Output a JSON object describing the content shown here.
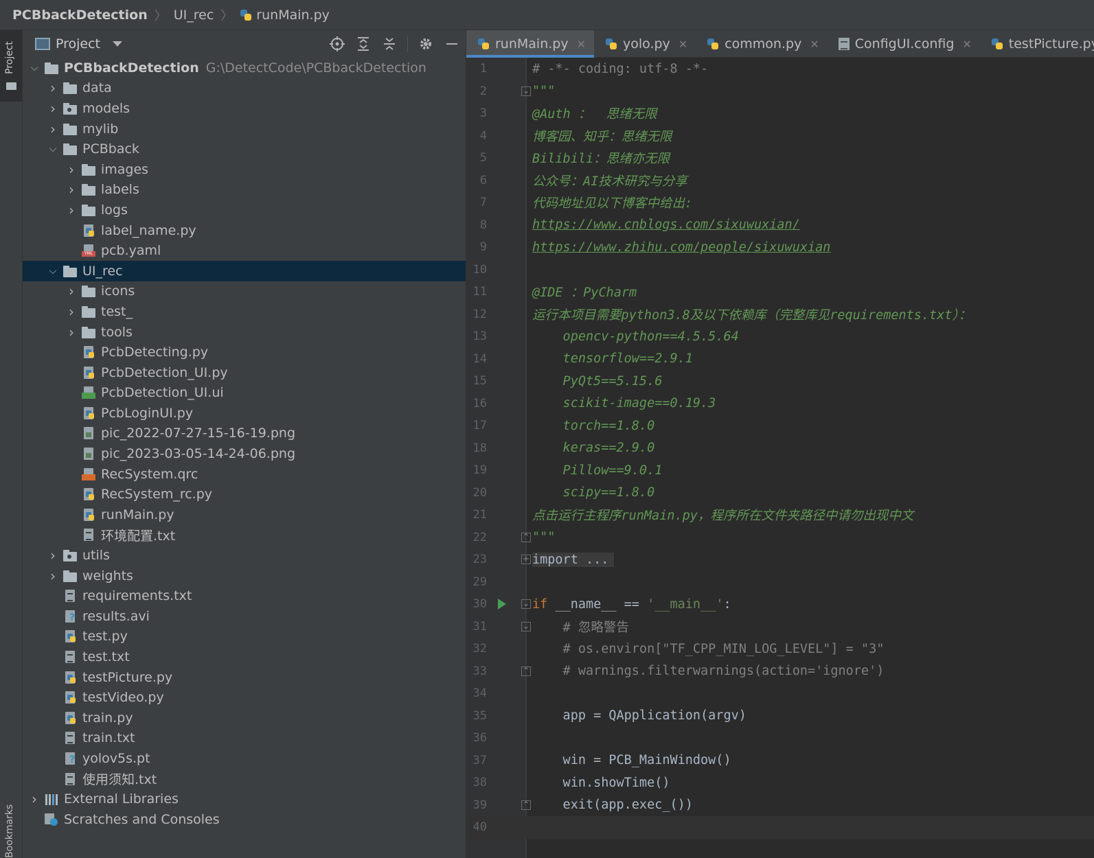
{
  "breadcrumb": {
    "root": "PCBbackDetection",
    "folder": "UI_rec",
    "file": "runMain.py"
  },
  "left_strip": {
    "project_label": "Project",
    "bookmarks_label": "Bookmarks"
  },
  "project_panel": {
    "title": "Project",
    "tool_icons": [
      "locate-icon",
      "expand-all-icon",
      "collapse-all-icon",
      "settings-icon",
      "hide-icon"
    ],
    "tree": [
      {
        "depth": 0,
        "expanded": true,
        "icon": "folder",
        "label": "PCBbackDetection",
        "path": "G:\\DetectCode\\PCBbackDetection",
        "bold": true
      },
      {
        "depth": 1,
        "expanded": false,
        "icon": "folder",
        "label": "data"
      },
      {
        "depth": 1,
        "expanded": false,
        "icon": "folder-pkg",
        "label": "models"
      },
      {
        "depth": 1,
        "expanded": false,
        "icon": "folder",
        "label": "mylib"
      },
      {
        "depth": 1,
        "expanded": true,
        "icon": "folder",
        "label": "PCBback"
      },
      {
        "depth": 2,
        "expanded": false,
        "icon": "folder",
        "label": "images"
      },
      {
        "depth": 2,
        "expanded": false,
        "icon": "folder",
        "label": "labels"
      },
      {
        "depth": 2,
        "expanded": false,
        "icon": "folder",
        "label": "logs"
      },
      {
        "depth": 2,
        "icon": "python",
        "label": "label_name.py"
      },
      {
        "depth": 2,
        "icon": "yaml",
        "label": "pcb.yaml"
      },
      {
        "depth": 1,
        "expanded": true,
        "icon": "folder",
        "label": "UI_rec",
        "selected": true
      },
      {
        "depth": 2,
        "expanded": false,
        "icon": "folder",
        "label": "icons"
      },
      {
        "depth": 2,
        "expanded": false,
        "icon": "folder",
        "label": "test_"
      },
      {
        "depth": 2,
        "expanded": false,
        "icon": "folder",
        "label": "tools"
      },
      {
        "depth": 2,
        "icon": "python",
        "label": "PcbDetecting.py"
      },
      {
        "depth": 2,
        "icon": "python",
        "label": "PcbDetection_UI.py"
      },
      {
        "depth": 2,
        "icon": "qt",
        "label": "PcbDetection_UI.ui"
      },
      {
        "depth": 2,
        "icon": "python",
        "label": "PcbLoginUI.py"
      },
      {
        "depth": 2,
        "icon": "image",
        "label": "pic_2022-07-27-15-16-19.png"
      },
      {
        "depth": 2,
        "icon": "image",
        "label": "pic_2023-03-05-14-24-06.png"
      },
      {
        "depth": 2,
        "icon": "qrc",
        "label": "RecSystem.qrc"
      },
      {
        "depth": 2,
        "icon": "python",
        "label": "RecSystem_rc.py"
      },
      {
        "depth": 2,
        "icon": "python",
        "label": "runMain.py"
      },
      {
        "depth": 2,
        "icon": "text",
        "label": "环境配置.txt"
      },
      {
        "depth": 1,
        "expanded": false,
        "icon": "folder-pkg",
        "label": "utils"
      },
      {
        "depth": 1,
        "expanded": false,
        "icon": "folder",
        "label": "weights"
      },
      {
        "depth": 1,
        "icon": "text",
        "label": "requirements.txt"
      },
      {
        "depth": 1,
        "icon": "unknown",
        "label": "results.avi"
      },
      {
        "depth": 1,
        "icon": "python",
        "label": "test.py"
      },
      {
        "depth": 1,
        "icon": "text",
        "label": "test.txt"
      },
      {
        "depth": 1,
        "icon": "python",
        "label": "testPicture.py"
      },
      {
        "depth": 1,
        "icon": "python",
        "label": "testVideo.py"
      },
      {
        "depth": 1,
        "icon": "python",
        "label": "train.py"
      },
      {
        "depth": 1,
        "icon": "text",
        "label": "train.txt"
      },
      {
        "depth": 1,
        "icon": "unknown",
        "label": "yolov5s.pt"
      },
      {
        "depth": 1,
        "icon": "text",
        "label": "使用须知.txt"
      },
      {
        "depth": 0,
        "expanded": false,
        "icon": "libs",
        "label": "External Libraries"
      },
      {
        "depth": 0,
        "icon": "scratch",
        "label": "Scratches and Consoles"
      }
    ]
  },
  "editor": {
    "tabs": [
      {
        "label": "runMain.py",
        "icon": "python",
        "active": true
      },
      {
        "label": "yolo.py",
        "icon": "python"
      },
      {
        "label": "common.py",
        "icon": "python"
      },
      {
        "label": "ConfigUI.config",
        "icon": "config"
      },
      {
        "label": "testPicture.py",
        "icon": "python"
      }
    ],
    "lines": [
      {
        "n": "1",
        "style": "comment",
        "text": "# -*- coding: utf-8 -*-"
      },
      {
        "n": "2",
        "style": "doc",
        "text": "\"\"\"",
        "fold": "open"
      },
      {
        "n": "3",
        "style": "doc",
        "text": "@Auth ：  思绪无限"
      },
      {
        "n": "4",
        "style": "doc",
        "text": "博客园、知乎：思绪无限"
      },
      {
        "n": "5",
        "style": "doc",
        "text": "Bilibili：思绪亦无限"
      },
      {
        "n": "6",
        "style": "doc",
        "text": "公众号：AI技术研究与分享"
      },
      {
        "n": "7",
        "style": "doc",
        "text": "代码地址见以下博客中给出:"
      },
      {
        "n": "8",
        "style": "link",
        "text": "https://www.cnblogs.com/sixuwuxian/"
      },
      {
        "n": "9",
        "style": "link",
        "text": "https://www.zhihu.com/people/sixuwuxian"
      },
      {
        "n": "10",
        "style": "doc",
        "text": ""
      },
      {
        "n": "11",
        "style": "doc",
        "text": "@IDE ：PyCharm"
      },
      {
        "n": "12",
        "style": "doc",
        "text": "运行本项目需要python3.8及以下依赖库（完整库见requirements.txt）："
      },
      {
        "n": "13",
        "style": "doc",
        "text": "    opencv-python==4.5.5.64"
      },
      {
        "n": "14",
        "style": "doc",
        "text": "    tensorflow==2.9.1"
      },
      {
        "n": "15",
        "style": "doc",
        "text": "    PyQt5==5.15.6"
      },
      {
        "n": "16",
        "style": "doc",
        "text": "    scikit-image==0.19.3"
      },
      {
        "n": "17",
        "style": "doc",
        "text": "    torch==1.8.0"
      },
      {
        "n": "18",
        "style": "doc",
        "text": "    keras==2.9.0"
      },
      {
        "n": "19",
        "style": "doc",
        "text": "    Pillow==9.0.1"
      },
      {
        "n": "20",
        "style": "doc",
        "text": "    scipy==1.8.0"
      },
      {
        "n": "21",
        "style": "doc",
        "text": "点击运行主程序runMain.py，程序所在文件夹路径中请勿出现中文"
      },
      {
        "n": "22",
        "style": "doc",
        "text": "\"\"\"",
        "fold": "close"
      },
      {
        "n": "23",
        "style": "fold",
        "text": "import ...",
        "fold": "plus"
      },
      {
        "n": "29",
        "style": "plain",
        "text": ""
      },
      {
        "n": "30",
        "style": "ifmain",
        "text": "",
        "fold": "open",
        "run": true
      },
      {
        "n": "31",
        "style": "comment",
        "text": "    # 忽略警告",
        "fold": "open"
      },
      {
        "n": "32",
        "style": "comment",
        "text": "    # os.environ[\"TF_CPP_MIN_LOG_LEVEL\"] = \"3\""
      },
      {
        "n": "33",
        "style": "comment",
        "text": "    # warnings.filterwarnings(action='ignore')",
        "fold": "close"
      },
      {
        "n": "34",
        "style": "plain",
        "text": ""
      },
      {
        "n": "35",
        "style": "plain",
        "text": "    app = QApplication(argv)"
      },
      {
        "n": "36",
        "style": "plain",
        "text": ""
      },
      {
        "n": "37",
        "style": "plain",
        "text": "    win = PCB_MainWindow()"
      },
      {
        "n": "38",
        "style": "plain",
        "text": "    win.showTime()"
      },
      {
        "n": "39",
        "style": "plain",
        "text": "    exit(app.exec_())",
        "fold": "close"
      },
      {
        "n": "40",
        "style": "plain",
        "text": "",
        "current": true
      }
    ],
    "ifmain_parts": {
      "kw": "if",
      "name": " __name__ == ",
      "str": "'__main__'",
      "tail": ":"
    }
  }
}
